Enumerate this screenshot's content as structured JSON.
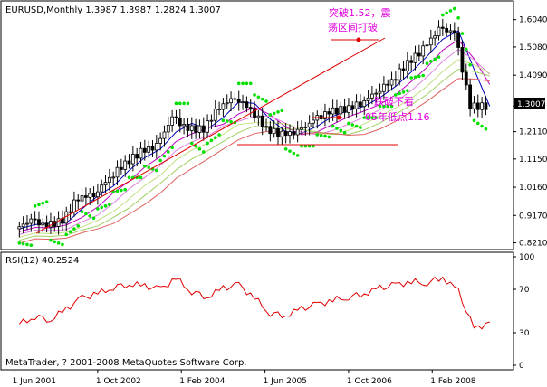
{
  "chart_data": [
    {
      "type": "line",
      "title": "EURUSD,Monthly  1.3987 1.3987 1.2824 1.3007",
      "ylim": [
        0.81,
        1.66
      ],
      "y_ticks": [
        "1.6040",
        "1.5080",
        "1.4090",
        "1.3007",
        "1.2110",
        "1.1150",
        "1.0160",
        "0.9170",
        "0.8210"
      ],
      "last_price": "1.3007",
      "x_ticks": [
        "1 Jun 2001",
        "1 Oct 2002",
        "1 Feb 2004",
        "1 Jun 2005",
        "1 Oct 2006",
        "1 Feb 2008"
      ],
      "x": [
        2001.5,
        2001.75,
        2002.0,
        2002.25,
        2002.5,
        2002.75,
        2003.0,
        2003.25,
        2003.5,
        2003.75,
        2004.0,
        2004.25,
        2004.5,
        2004.75,
        2005.0,
        2005.25,
        2005.5,
        2005.75,
        2006.0,
        2006.25,
        2006.5,
        2006.75,
        2007.0,
        2007.25,
        2007.5,
        2007.75,
        2008.0,
        2008.25,
        2008.5,
        2008.75,
        2009.0
      ],
      "series": [
        {
          "values": [
            0.87,
            0.9,
            0.88,
            0.9,
            0.98,
            0.99,
            1.05,
            1.1,
            1.14,
            1.16,
            1.26,
            1.22,
            1.22,
            1.3,
            1.33,
            1.29,
            1.22,
            1.2,
            1.21,
            1.25,
            1.28,
            1.29,
            1.31,
            1.35,
            1.39,
            1.45,
            1.5,
            1.57,
            1.56,
            1.3,
            1.3
          ]
        }
      ],
      "annotations": [
        {
          "text": "突破1.52，震荡区间打破",
          "line1": "突破1.52，震",
          "line2": "荡区间打破",
          "color": "#e000e0"
        },
        {
          "text": "跌破下看05年低点1.16",
          "line1": "跌破下看",
          "line2": "05年低点1.16",
          "color": "#e000e0"
        }
      ]
    },
    {
      "type": "line",
      "title": "RSI(12) 40.2524",
      "ylim": [
        0,
        100
      ],
      "y_ticks": [
        "100",
        "70",
        "30",
        "0"
      ],
      "series": [
        {
          "name": "RSI(12)",
          "values": [
            38,
            45,
            42,
            52,
            62,
            66,
            72,
            75,
            73,
            70,
            80,
            68,
            63,
            71,
            74,
            62,
            48,
            46,
            52,
            56,
            60,
            63,
            66,
            71,
            74,
            77,
            76,
            81,
            68,
            33,
            40
          ]
        }
      ],
      "color": "#e00000"
    }
  ],
  "footer": {
    "copyright": "MetaTrader, ? 2001-2008 MetaQuotes Software Corp."
  },
  "colors": {
    "background": "#ffffff",
    "candle": "#000000",
    "sar": "#00e000",
    "rsi": "#e00000",
    "annotation": "#e000e0",
    "trend": "#e00000"
  }
}
